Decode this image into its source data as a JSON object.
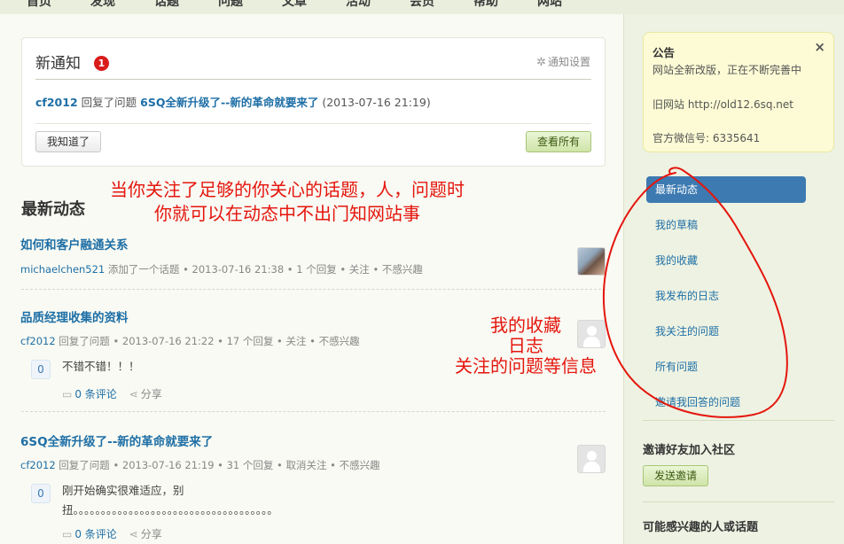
{
  "nav": {
    "items": [
      "首页",
      "发现",
      "话题",
      "问题",
      "文章",
      "活动",
      "会员",
      "帮助",
      "网站"
    ]
  },
  "notice": {
    "title": "新通知",
    "badge": "1",
    "settings": "通知设置",
    "item": {
      "user": "cf2012",
      "action": "回复了问题",
      "question": "6SQ全新升级了--新的革命就要来了",
      "time": "(2013-07-16 21:19)"
    },
    "dismiss_button": "我知道了",
    "view_all_button": "查看所有"
  },
  "feed": {
    "title": "最新动态",
    "items": [
      {
        "title": "如何和客户融通关系",
        "user": "michaelchen521",
        "meta": "添加了一个话题 • 2013-07-16 21:38 • 1 个回复 • 关注 • 不感兴趣"
      },
      {
        "title": "品质经理收集的资料",
        "user": "cf2012",
        "meta": "回复了问题 • 2013-07-16 21:22 • 17 个回复 • 关注 • 不感兴趣",
        "votes": "0",
        "answer": "不错不错！！！",
        "comments": "0 条评论",
        "share": "分享"
      },
      {
        "title": "6SQ全新升级了--新的革命就要来了",
        "user": "cf2012",
        "meta": "回复了问题 • 2013-07-16 21:19 • 31 个回复 • 取消关注 • 不感兴趣",
        "votes": "0",
        "answer_line1": "刚开始确实很难适应，别",
        "answer_line2": "扭。。。。。。。。。。。。。。。。。。。。。。。。。。。。。。。。。。。。",
        "comments": "0 条评论",
        "share": "分享"
      }
    ]
  },
  "annotations": {
    "note1_line1": "当你关注了足够的你关心的话题，人，问题时",
    "note1_line2": "你就可以在动态中不出门知网站事",
    "note2_line1": "我的收藏",
    "note2_line2": "日志",
    "note2_line3": "关注的问题等信息",
    "color": "#e4160e"
  },
  "sidebar": {
    "announcement": {
      "title": "公告",
      "close": "×",
      "line1": "网站全新改版，正在不断完善中",
      "line2": "旧网站 http://old12.6sq.net",
      "line3": "官方微信号: 6335641"
    },
    "menu": [
      "最新动态",
      "我的草稿",
      "我的收藏",
      "我发布的日志",
      "我关注的问题",
      "所有问题",
      "邀请我回答的问题"
    ],
    "invite_heading": "邀请好友加入社区",
    "invite_button": "发送邀请",
    "interest_heading": "可能感兴趣的人或话题"
  },
  "colors": {
    "link": "#1e6fa6",
    "active_menu": "#3d7ab1",
    "badge": "#d91b1b"
  }
}
